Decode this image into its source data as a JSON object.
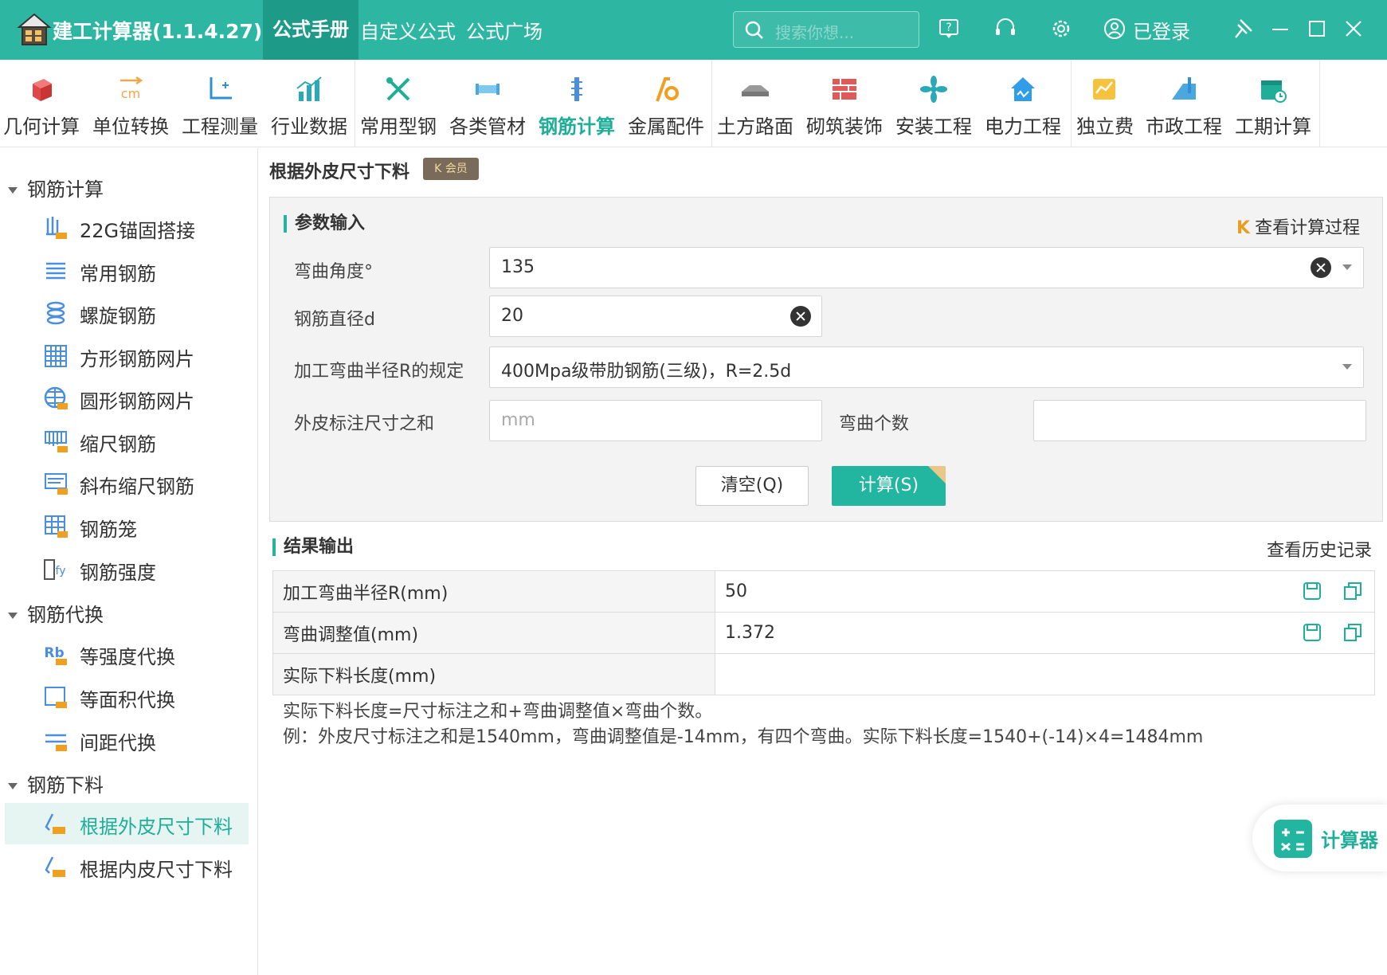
{
  "titlebar": {
    "app_title": "建工计算器(1.1.4.27)",
    "tabs": [
      "公式手册",
      "自定义公式",
      "公式广场"
    ],
    "search_placeholder": "搜索你想...",
    "login_label": "已登录"
  },
  "toolbar": {
    "items": [
      {
        "label": "几何计算",
        "icon": "cube-icon"
      },
      {
        "label": "单位转换",
        "icon": "cm-convert-icon"
      },
      {
        "label": "工程测量",
        "icon": "axis-icon"
      },
      {
        "label": "行业数据",
        "icon": "bar-chart-icon"
      },
      {
        "label": "常用型钢",
        "icon": "tools-icon"
      },
      {
        "label": "各类管材",
        "icon": "pipe-icon"
      },
      {
        "label": "钢筋计算",
        "icon": "rebar-icon"
      },
      {
        "label": "金属配件",
        "icon": "metal-fitting-icon"
      },
      {
        "label": "土方路面",
        "icon": "earthwork-icon"
      },
      {
        "label": "砌筑装饰",
        "icon": "brick-icon"
      },
      {
        "label": "安装工程",
        "icon": "fan-icon"
      },
      {
        "label": "电力工程",
        "icon": "power-house-icon"
      },
      {
        "label": "独立费",
        "icon": "fee-icon"
      },
      {
        "label": "市政工程",
        "icon": "municipal-icon"
      },
      {
        "label": "工期计算",
        "icon": "calendar-icon"
      }
    ],
    "active": "钢筋计算"
  },
  "sidebar": {
    "groups": [
      {
        "label": "钢筋计算",
        "items": [
          "22G锚固搭接",
          "常用钢筋",
          "螺旋钢筋",
          "方形钢筋网片",
          "圆形钢筋网片",
          "缩尺钢筋",
          "斜布缩尺钢筋",
          "钢筋笼",
          "钢筋强度"
        ]
      },
      {
        "label": "钢筋代换",
        "items": [
          "等强度代换",
          "等面积代换",
          "间距代换"
        ]
      },
      {
        "label": "钢筋下料",
        "items": [
          "根据外皮尺寸下料",
          "根据内皮尺寸下料"
        ]
      }
    ],
    "active_item": "根据外皮尺寸下料"
  },
  "main": {
    "page_title": "根据外皮尺寸下料",
    "vip_badge": "会员",
    "input_section": {
      "title": "参数输入",
      "view_process_link": "查看计算过程",
      "fields": {
        "bend_angle": {
          "label": "弯曲角度°",
          "value": "135"
        },
        "diameter": {
          "label": "钢筋直径d",
          "value": "20"
        },
        "radius_rule": {
          "label": "加工弯曲半径R的规定",
          "value": "400Mpa级带肋钢筋(三级)，R=2.5d"
        },
        "outer_sum": {
          "label": "外皮标注尺寸之和",
          "placeholder": "mm",
          "value": ""
        },
        "bend_count": {
          "label": "弯曲个数",
          "value": ""
        }
      },
      "clear_button": "清空(Q)",
      "calc_button": "计算(S)"
    },
    "result_section": {
      "title": "结果输出",
      "history_link": "查看历史记录",
      "rows": [
        {
          "key": "加工弯曲半径R(mm)",
          "value": "50"
        },
        {
          "key": "弯曲调整值(mm)",
          "value": "1.372"
        },
        {
          "key": "实际下料长度(mm)",
          "value": ""
        }
      ],
      "note_line1": "实际下料长度=尺寸标注之和+弯曲调整值×弯曲个数。",
      "note_line2": "例：外皮尺寸标注之和是1540mm，弯曲调整值是-14mm，有四个弯曲。实际下料长度=1540+(-14)×4=1484mm"
    },
    "floating_calc": "计算器"
  },
  "colors": {
    "primary": "#2db7a3",
    "primary_dark": "#1d9a88",
    "accent_text": "#1fae98"
  }
}
